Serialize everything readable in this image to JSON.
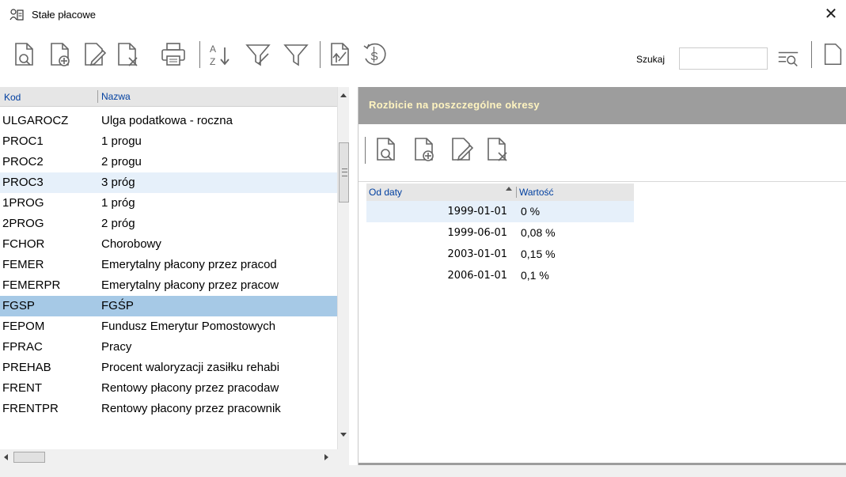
{
  "window": {
    "title": "Stałe płacowe",
    "close_glyph": "✕"
  },
  "toolbar": {
    "icons": [
      "view-icon",
      "add-icon",
      "edit-icon",
      "delete-icon",
      "print-icon",
      "sort-az-icon",
      "filter-clear-icon",
      "filter-icon",
      "export-icon",
      "currency-icon"
    ],
    "search_label": "Szukaj",
    "search_value": ""
  },
  "left_grid": {
    "columns": [
      "Kod",
      "Nazwa"
    ],
    "rows": [
      {
        "kod": "ULGAROCZ",
        "nazwa": "Ulga podatkowa - roczna"
      },
      {
        "kod": "PROC1",
        "nazwa": "1 progu"
      },
      {
        "kod": "PROC2",
        "nazwa": "2 progu"
      },
      {
        "kod": "PROC3",
        "nazwa": "3 próg"
      },
      {
        "kod": "1PROG",
        "nazwa": "1 próg"
      },
      {
        "kod": "2PROG",
        "nazwa": "2 próg"
      },
      {
        "kod": "FCHOR",
        "nazwa": "Chorobowy"
      },
      {
        "kod": "FEMER",
        "nazwa": "Emerytalny płacony przez pracod"
      },
      {
        "kod": "FEMERPR",
        "nazwa": "Emerytalny płacony przez pracow"
      },
      {
        "kod": "FGSP",
        "nazwa": "FGŚP"
      },
      {
        "kod": "FEPOM",
        "nazwa": "Fundusz Emerytur Pomostowych"
      },
      {
        "kod": "FPRAC",
        "nazwa": "Pracy"
      },
      {
        "kod": "PREHAB",
        "nazwa": "Procent waloryzacji zasiłku rehabi"
      },
      {
        "kod": "FRENT",
        "nazwa": "Rentowy płacony przez pracodaw"
      },
      {
        "kod": "FRENTPR",
        "nazwa": "Rentowy płacony przez pracownik"
      }
    ]
  },
  "right_panel": {
    "header": "Rozbicie na poszczególne okresy",
    "columns": [
      "Od daty",
      "Wartość"
    ],
    "rows": [
      {
        "od_daty": "1999-01-01",
        "wartosc": "0 %"
      },
      {
        "od_daty": "1999-06-01",
        "wartosc": "0,08 %"
      },
      {
        "od_daty": "2003-01-01",
        "wartosc": "0,15 %"
      },
      {
        "od_daty": "2006-01-01",
        "wartosc": "0,1 %"
      }
    ]
  },
  "colors": {
    "header_text": "#fff4c0",
    "panel_header_bg": "#9d9d9d",
    "selected_row": "#a6c9e6",
    "hover_row": "#e6f0fa",
    "column_header_text": "#003fa0"
  }
}
